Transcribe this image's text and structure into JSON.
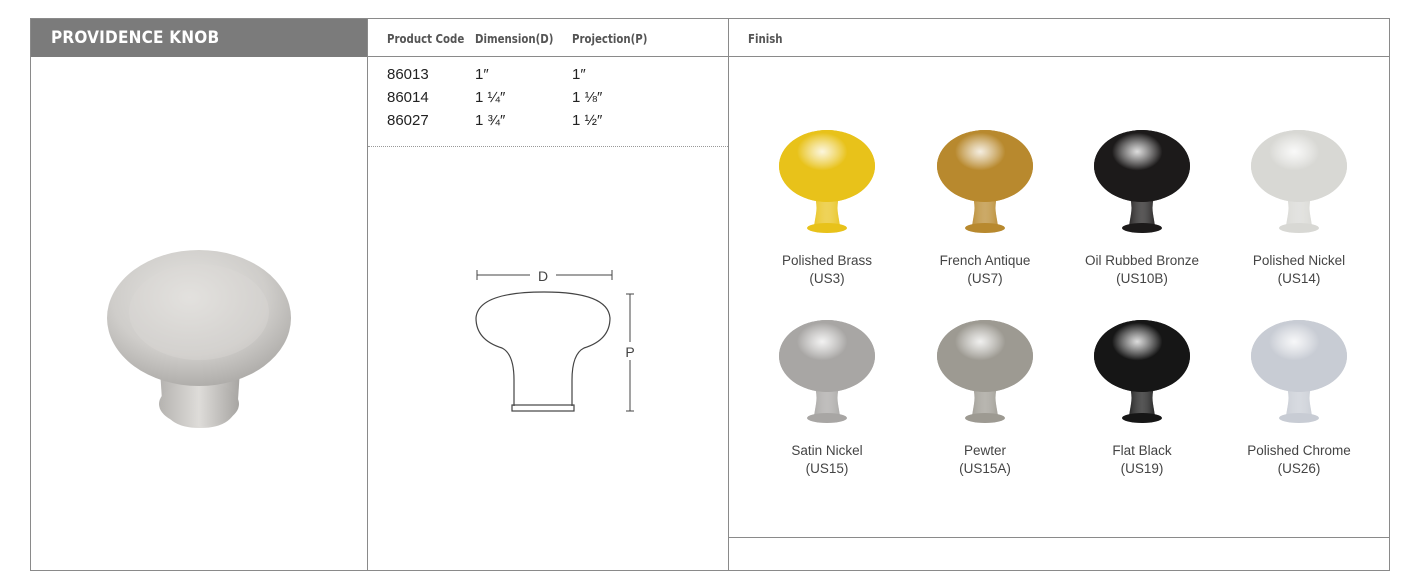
{
  "title": "PROVIDENCE KNOB",
  "headers": {
    "product_code": "Product Code",
    "dimension": "Dimension(D)",
    "projection": "Projection(P)",
    "finish": "Finish"
  },
  "specs": [
    {
      "code": "86013",
      "dimension": "1″",
      "projection": "1″"
    },
    {
      "code": "86014",
      "dimension": "1 ¼″",
      "projection": "1 ⅛″"
    },
    {
      "code": "86027",
      "dimension": "1 ¾″",
      "projection": "1 ½″"
    }
  ],
  "diagram": {
    "d_label": "D",
    "p_label": "P"
  },
  "finishes": [
    {
      "name": "Polished Brass",
      "code": "(US3)",
      "color": "#e8c21a"
    },
    {
      "name": "French Antique",
      "code": "(US7)",
      "color": "#b8892e"
    },
    {
      "name": "Oil Rubbed Bronze",
      "code": "(US10B)",
      "color": "#1c1a1a"
    },
    {
      "name": "Polished Nickel",
      "code": "(US14)",
      "color": "#d8d8d4"
    },
    {
      "name": "Satin Nickel",
      "code": "(US15)",
      "color": "#a8a6a4"
    },
    {
      "name": "Pewter",
      "code": "(US15A)",
      "color": "#9d9a92"
    },
    {
      "name": "Flat Black",
      "code": "(US19)",
      "color": "#161616"
    },
    {
      "name": "Polished Chrome",
      "code": "(US26)",
      "color": "#c8ccd4"
    }
  ]
}
